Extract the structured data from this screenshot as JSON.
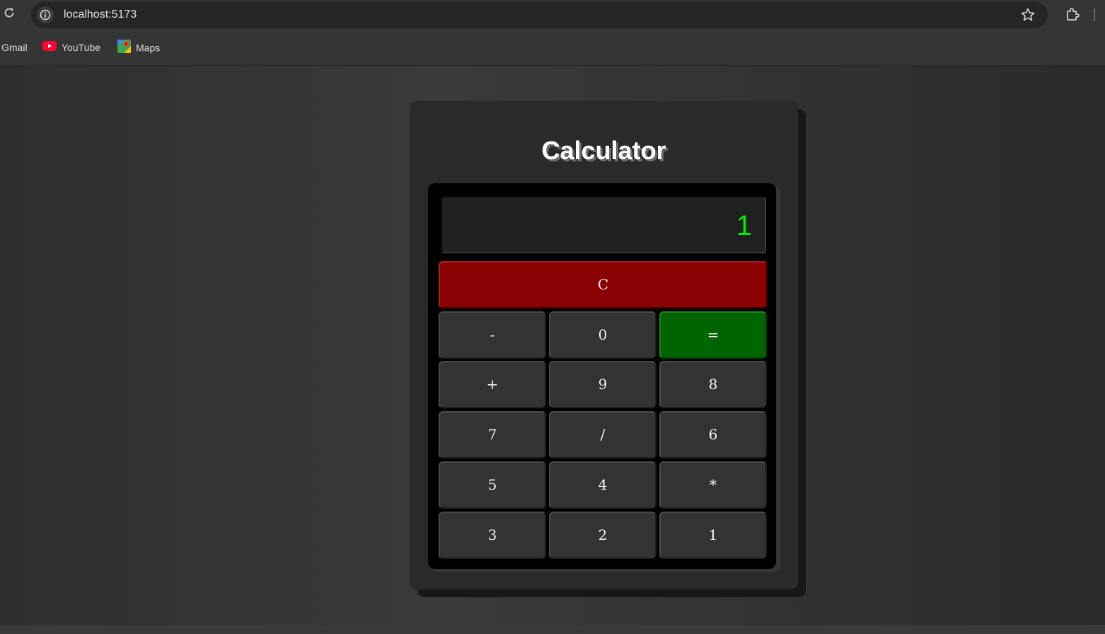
{
  "browser": {
    "url": "localhost:5173",
    "bookmarks": [
      {
        "label": "Gmail",
        "icon": "gmail-icon"
      },
      {
        "label": "YouTube",
        "icon": "youtube-icon"
      },
      {
        "label": "Maps",
        "icon": "maps-icon"
      }
    ]
  },
  "calculator": {
    "title": "Calculator",
    "display": "1",
    "buttons": {
      "clear": "C",
      "minus": "-",
      "zero": "0",
      "equals": "=",
      "plus": "+",
      "nine": "9",
      "eight": "8",
      "seven": "7",
      "divide": "/",
      "six": "6",
      "five": "5",
      "four": "4",
      "multiply": "*",
      "three": "3",
      "two": "2",
      "one": "1"
    },
    "colors": {
      "clear": "#8b0000",
      "equals": "#006400",
      "display_text": "#00ee00"
    }
  }
}
